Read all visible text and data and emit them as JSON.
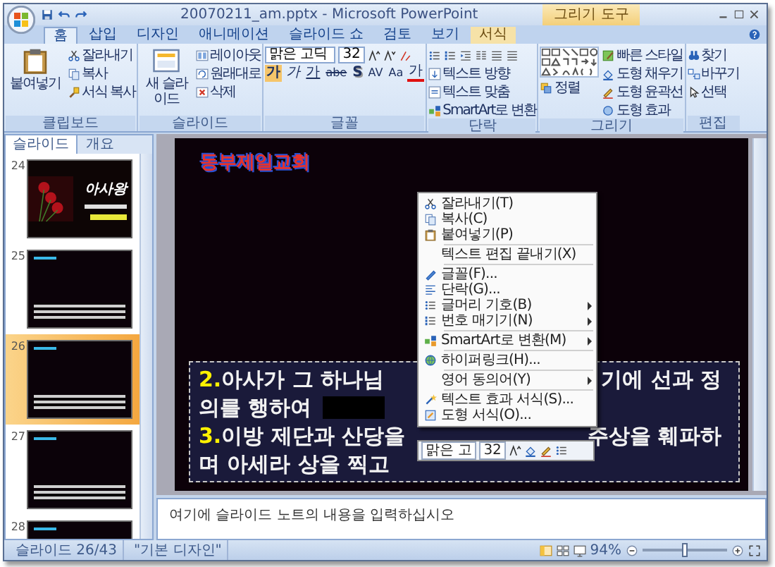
{
  "window": {
    "title": "20070211_am.pptx - Microsoft PowerPoint",
    "tool_group": "그리기 도구"
  },
  "tabs": [
    {
      "label": "홈",
      "selected": true,
      "contextual": false
    },
    {
      "label": "삽입",
      "selected": false,
      "contextual": false
    },
    {
      "label": "디자인",
      "selected": false,
      "contextual": false
    },
    {
      "label": "애니메이션",
      "selected": false,
      "contextual": false
    },
    {
      "label": "슬라이드 쇼",
      "selected": false,
      "contextual": false
    },
    {
      "label": "검토",
      "selected": false,
      "contextual": false
    },
    {
      "label": "보기",
      "selected": false,
      "contextual": false
    },
    {
      "label": "서식",
      "selected": false,
      "contextual": true
    }
  ],
  "ribbon": {
    "clipboard": {
      "label": "클립보드",
      "paste": "붙여넣기",
      "items": [
        "잘라내기",
        "복사",
        "서식 복사"
      ]
    },
    "slides": {
      "label": "슬라이드",
      "new_slide": "새 슬라이드",
      "items": [
        "레이아웃",
        "원래대로",
        "삭제"
      ]
    },
    "font": {
      "label": "글꼴",
      "face": "맑은 고딕",
      "size": "32",
      "buttons": [
        "가",
        "가",
        "가",
        "abe",
        "S",
        "AV",
        "Aa",
        "가"
      ]
    },
    "paragraph": {
      "label": "단락",
      "items": [
        "텍스트 방향",
        "텍스트 맞춤",
        "SmartArt로 변환"
      ]
    },
    "drawing": {
      "label": "그리기",
      "arrange": "정렬",
      "quick_styles": "빠른 스타일",
      "items": [
        "도형 채우기",
        "도형 윤곽선",
        "도형 효과"
      ]
    },
    "editing": {
      "label": "편집",
      "items": [
        "찾기",
        "바꾸기",
        "선택"
      ]
    }
  },
  "pane_tabs": [
    {
      "label": "슬라이드",
      "selected": true
    },
    {
      "label": "개요",
      "selected": false
    }
  ],
  "thumbnails": [
    {
      "number": "24",
      "kind": "title",
      "selected": false,
      "title": "아사왕"
    },
    {
      "number": "25",
      "kind": "text",
      "selected": false
    },
    {
      "number": "26",
      "kind": "text",
      "selected": true
    },
    {
      "number": "27",
      "kind": "text",
      "selected": false
    },
    {
      "number": "28",
      "kind": "text",
      "selected": false
    }
  ],
  "slide": {
    "title": "동부제일교회",
    "lines": [
      {
        "number": "2.",
        "text": "아사가 그 하나님",
        "continued": "기에 선과 정"
      },
      {
        "text": "의를 행하여"
      },
      {
        "number": "3.",
        "text": "이방 제단과 산당을",
        "continued": "주상을 훼파하"
      },
      {
        "text": "며 아세라 상을 찍고"
      }
    ]
  },
  "context_menu": [
    {
      "label": "잘라내기(T)",
      "separator": false,
      "icon": true,
      "submenu": false
    },
    {
      "label": "복사(C)",
      "separator": false,
      "icon": true,
      "submenu": false
    },
    {
      "label": "붙여넣기(P)",
      "separator": false,
      "icon": true,
      "submenu": false
    },
    {
      "label": "텍스트 편집 끝내기(X)",
      "separator": true,
      "icon": false,
      "submenu": false
    },
    {
      "label": "글꼴(F)...",
      "separator": true,
      "icon": true,
      "submenu": false
    },
    {
      "label": "단락(G)...",
      "separator": false,
      "icon": true,
      "submenu": false
    },
    {
      "label": "글머리 기호(B)",
      "separator": false,
      "icon": true,
      "submenu": true
    },
    {
      "label": "번호 매기기(N)",
      "separator": false,
      "icon": true,
      "submenu": true
    },
    {
      "label": "SmartArt로 변환(M)",
      "separator": true,
      "icon": true,
      "submenu": true
    },
    {
      "label": "하이퍼링크(H)...",
      "separator": true,
      "icon": true,
      "submenu": false
    },
    {
      "label": "영어 동의어(Y)",
      "separator": true,
      "icon": false,
      "submenu": true
    },
    {
      "label": "텍스트 효과 서식(S)...",
      "separator": true,
      "icon": true,
      "submenu": false
    },
    {
      "label": "도형 서식(O)...",
      "separator": false,
      "icon": true,
      "submenu": false
    }
  ],
  "mini_toolbar": {
    "font": "맑은 고",
    "size": "32"
  },
  "notes": {
    "placeholder": "여기에 슬라이드 노트의 내용을 입력하십시오"
  },
  "status_bar": {
    "slide": "슬라이드 26/43",
    "theme": "\"기본 디자인\"",
    "zoom": "94%",
    "zoom_slider": {
      "level": 0.5
    }
  }
}
